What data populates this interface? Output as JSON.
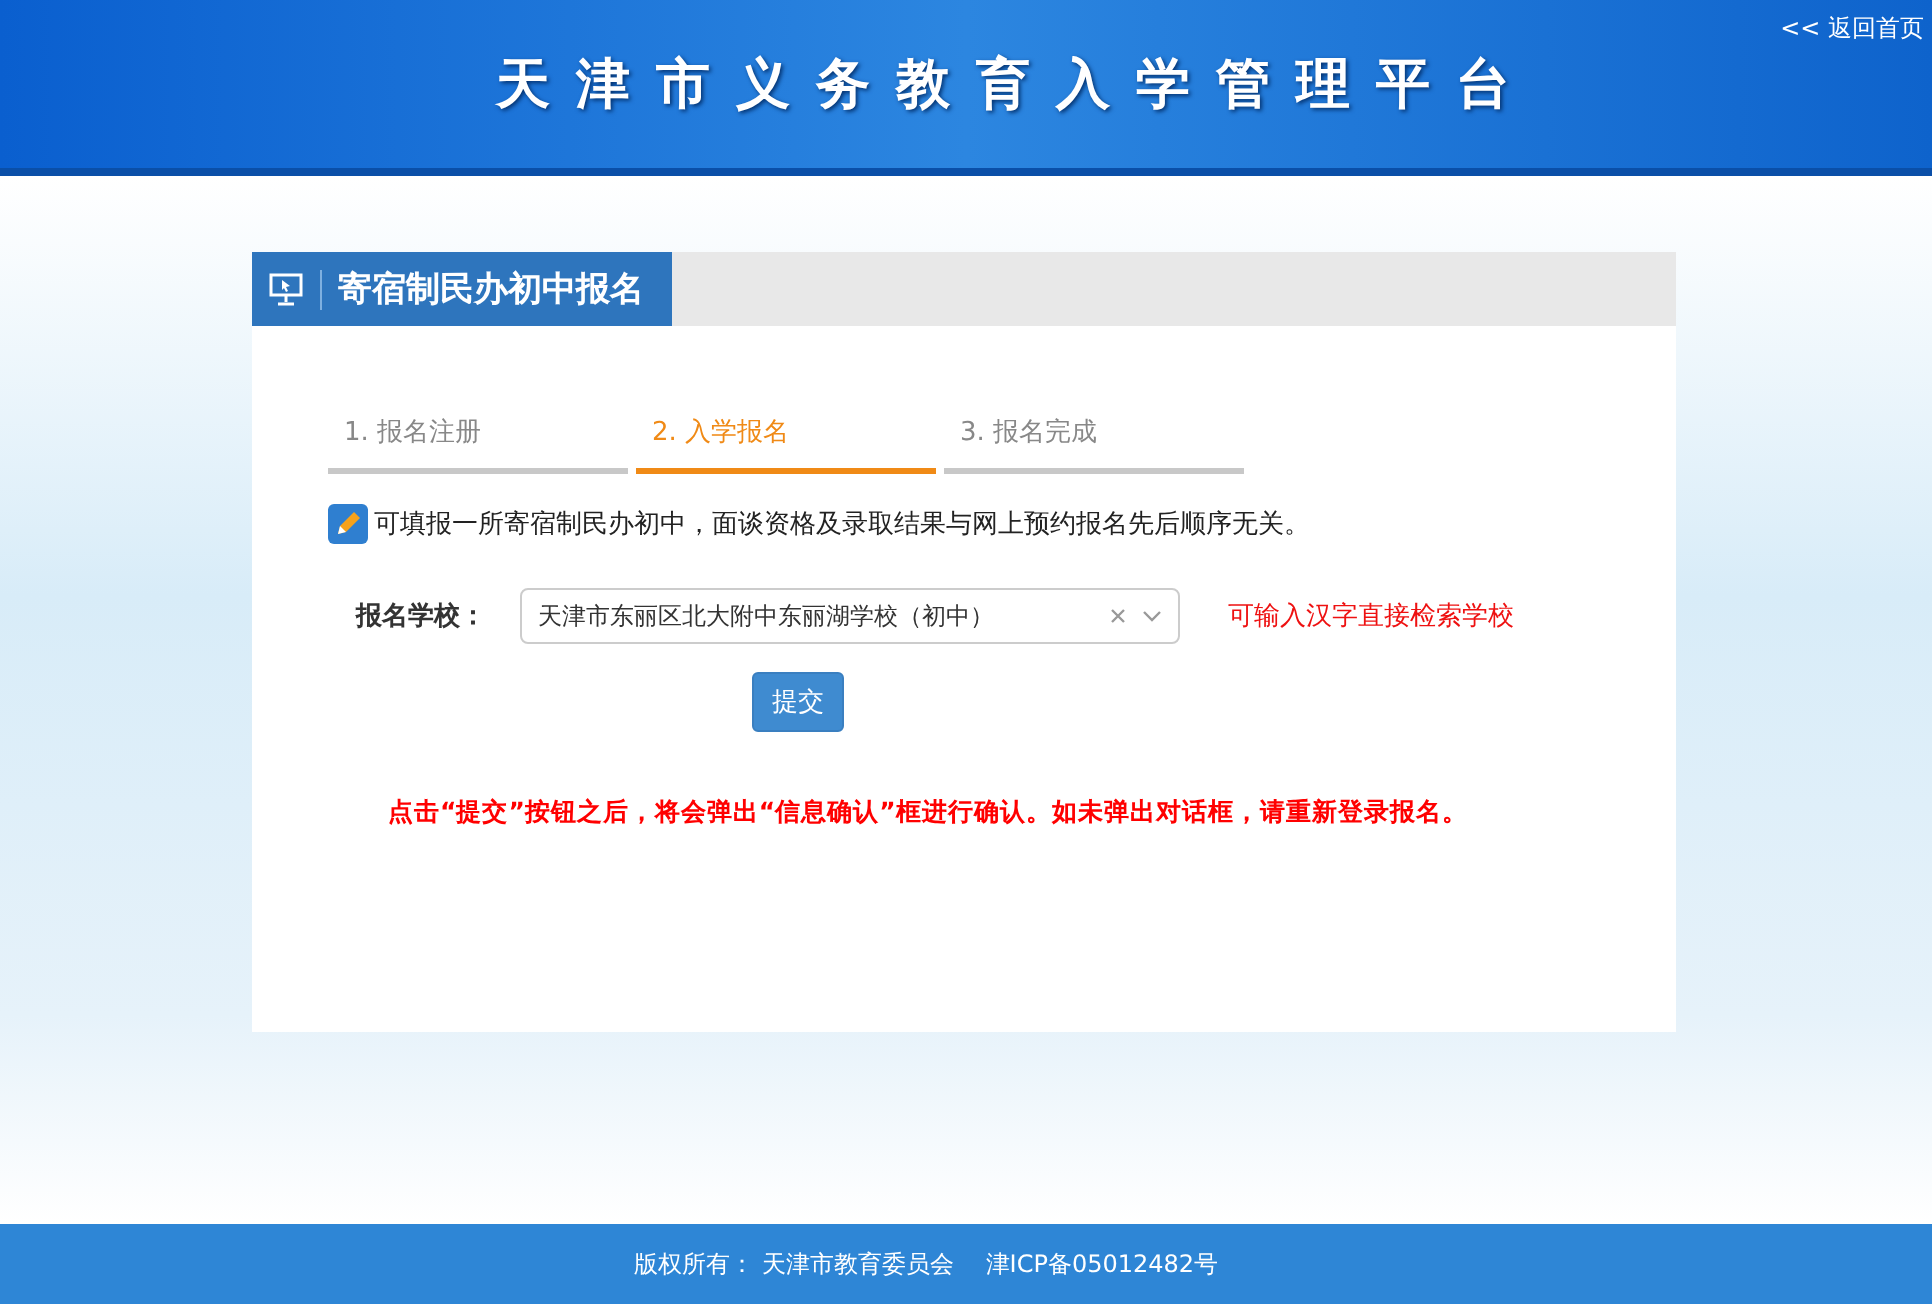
{
  "header": {
    "title": "天津市义务教育入学管理平台",
    "back_link": "<< 返回首页"
  },
  "panel": {
    "title": "寄宿制民办初中报名",
    "steps": [
      {
        "label": "1. 报名注册",
        "selected": false
      },
      {
        "label": "2. 入学报名",
        "selected": true
      },
      {
        "label": "3. 报名完成",
        "selected": false
      }
    ],
    "notice": "可填报一所寄宿制民办初中，面谈资格及录取结果与网上预约报名先后顺序无关。",
    "school_field": {
      "label": "报名学校：",
      "value": "天津市东丽区北大附中东丽湖学校（初中）",
      "hint": "可输入汉字直接检索学校"
    },
    "submit_button": "提交",
    "warning": "点击“提交”按钮之后，将会弹出“信息确认”框进行确认。如未弹出对话框，请重新登录报名。"
  },
  "footer": {
    "copyright": "版权所有：  天津市教育委员会",
    "icp": "津ICP备05012482号"
  }
}
